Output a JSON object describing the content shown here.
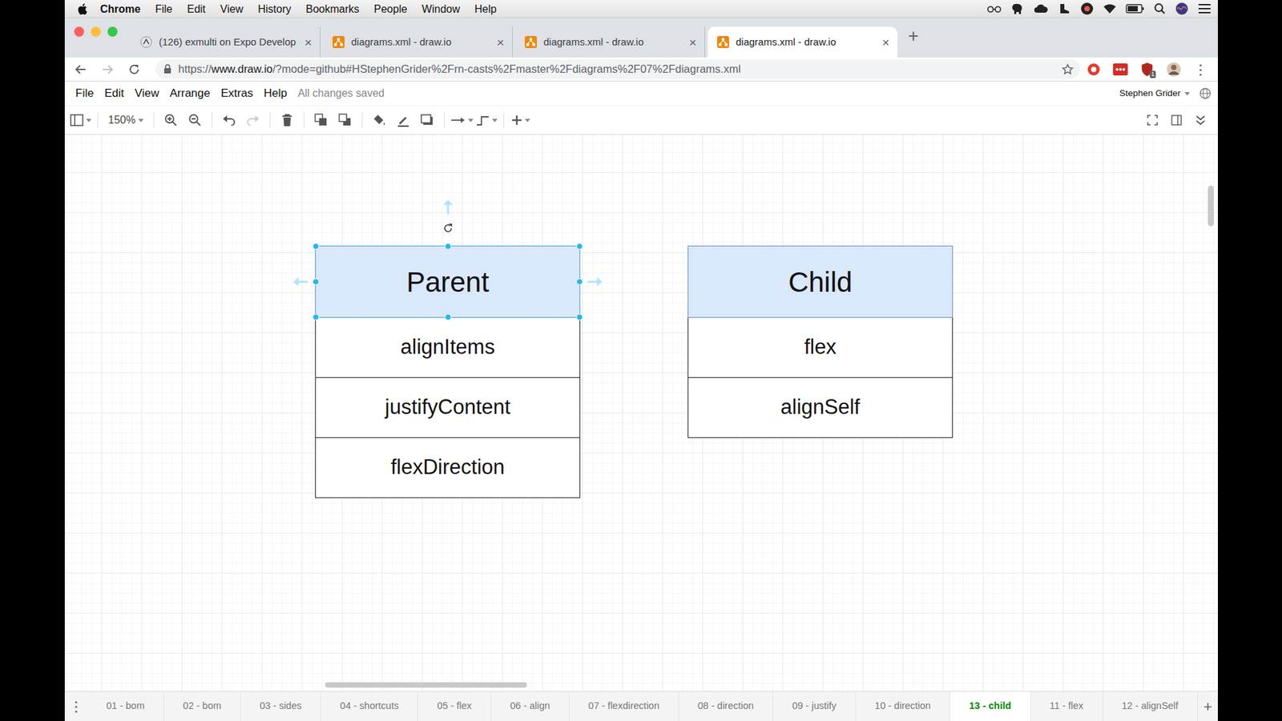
{
  "menubar": {
    "app": "Chrome",
    "items": [
      "File",
      "Edit",
      "View",
      "History",
      "Bookmarks",
      "People",
      "Window",
      "Help"
    ]
  },
  "browser": {
    "tabs": [
      {
        "label": "(126) exmulti on Expo Develop",
        "selected": false,
        "kind": "expo"
      },
      {
        "label": "diagrams.xml - draw.io",
        "selected": false,
        "kind": "drawio"
      },
      {
        "label": "diagrams.xml - draw.io",
        "selected": false,
        "kind": "drawio"
      },
      {
        "label": "diagrams.xml - draw.io",
        "selected": true,
        "kind": "drawio"
      }
    ],
    "close": "×",
    "new_tab": "+",
    "address": {
      "scheme": "https://",
      "host": "www.draw.io",
      "path": "/?mode=github#HStephenGrider%2Frn-casts%2Fmaster%2Fdiagrams%2F07%2Fdiagrams.xml"
    },
    "extension_badge": "1",
    "menu": "⋮"
  },
  "app": {
    "menu": [
      "File",
      "Edit",
      "View",
      "Arrange",
      "Extras",
      "Help"
    ],
    "save_status": "All changes saved",
    "user": "Stephen Grider",
    "zoom": "150%"
  },
  "diagram": {
    "nodes": [
      {
        "title": "Parent",
        "selected": true,
        "rows": [
          "alignItems",
          "justifyContent",
          "flexDirection"
        ]
      },
      {
        "title": "Child",
        "selected": false,
        "rows": [
          "flex",
          "alignSelf"
        ]
      }
    ]
  },
  "pages": {
    "menu": "⋮",
    "add": "+",
    "items": [
      {
        "label": "01 - bom",
        "selected": false
      },
      {
        "label": "02 - bom",
        "selected": false
      },
      {
        "label": "03 - sides",
        "selected": false
      },
      {
        "label": "04 - shortcuts",
        "selected": false
      },
      {
        "label": "05 - flex",
        "selected": false
      },
      {
        "label": "06 - align",
        "selected": false
      },
      {
        "label": "07 - flexdirection",
        "selected": false
      },
      {
        "label": "08 - direction",
        "selected": false
      },
      {
        "label": "09 - justify",
        "selected": false
      },
      {
        "label": "10 - direction",
        "selected": false
      },
      {
        "label": "13 - child",
        "selected": true
      },
      {
        "label": "11 - flex",
        "selected": false
      },
      {
        "label": "12 - alignSelf",
        "selected": false
      }
    ]
  }
}
